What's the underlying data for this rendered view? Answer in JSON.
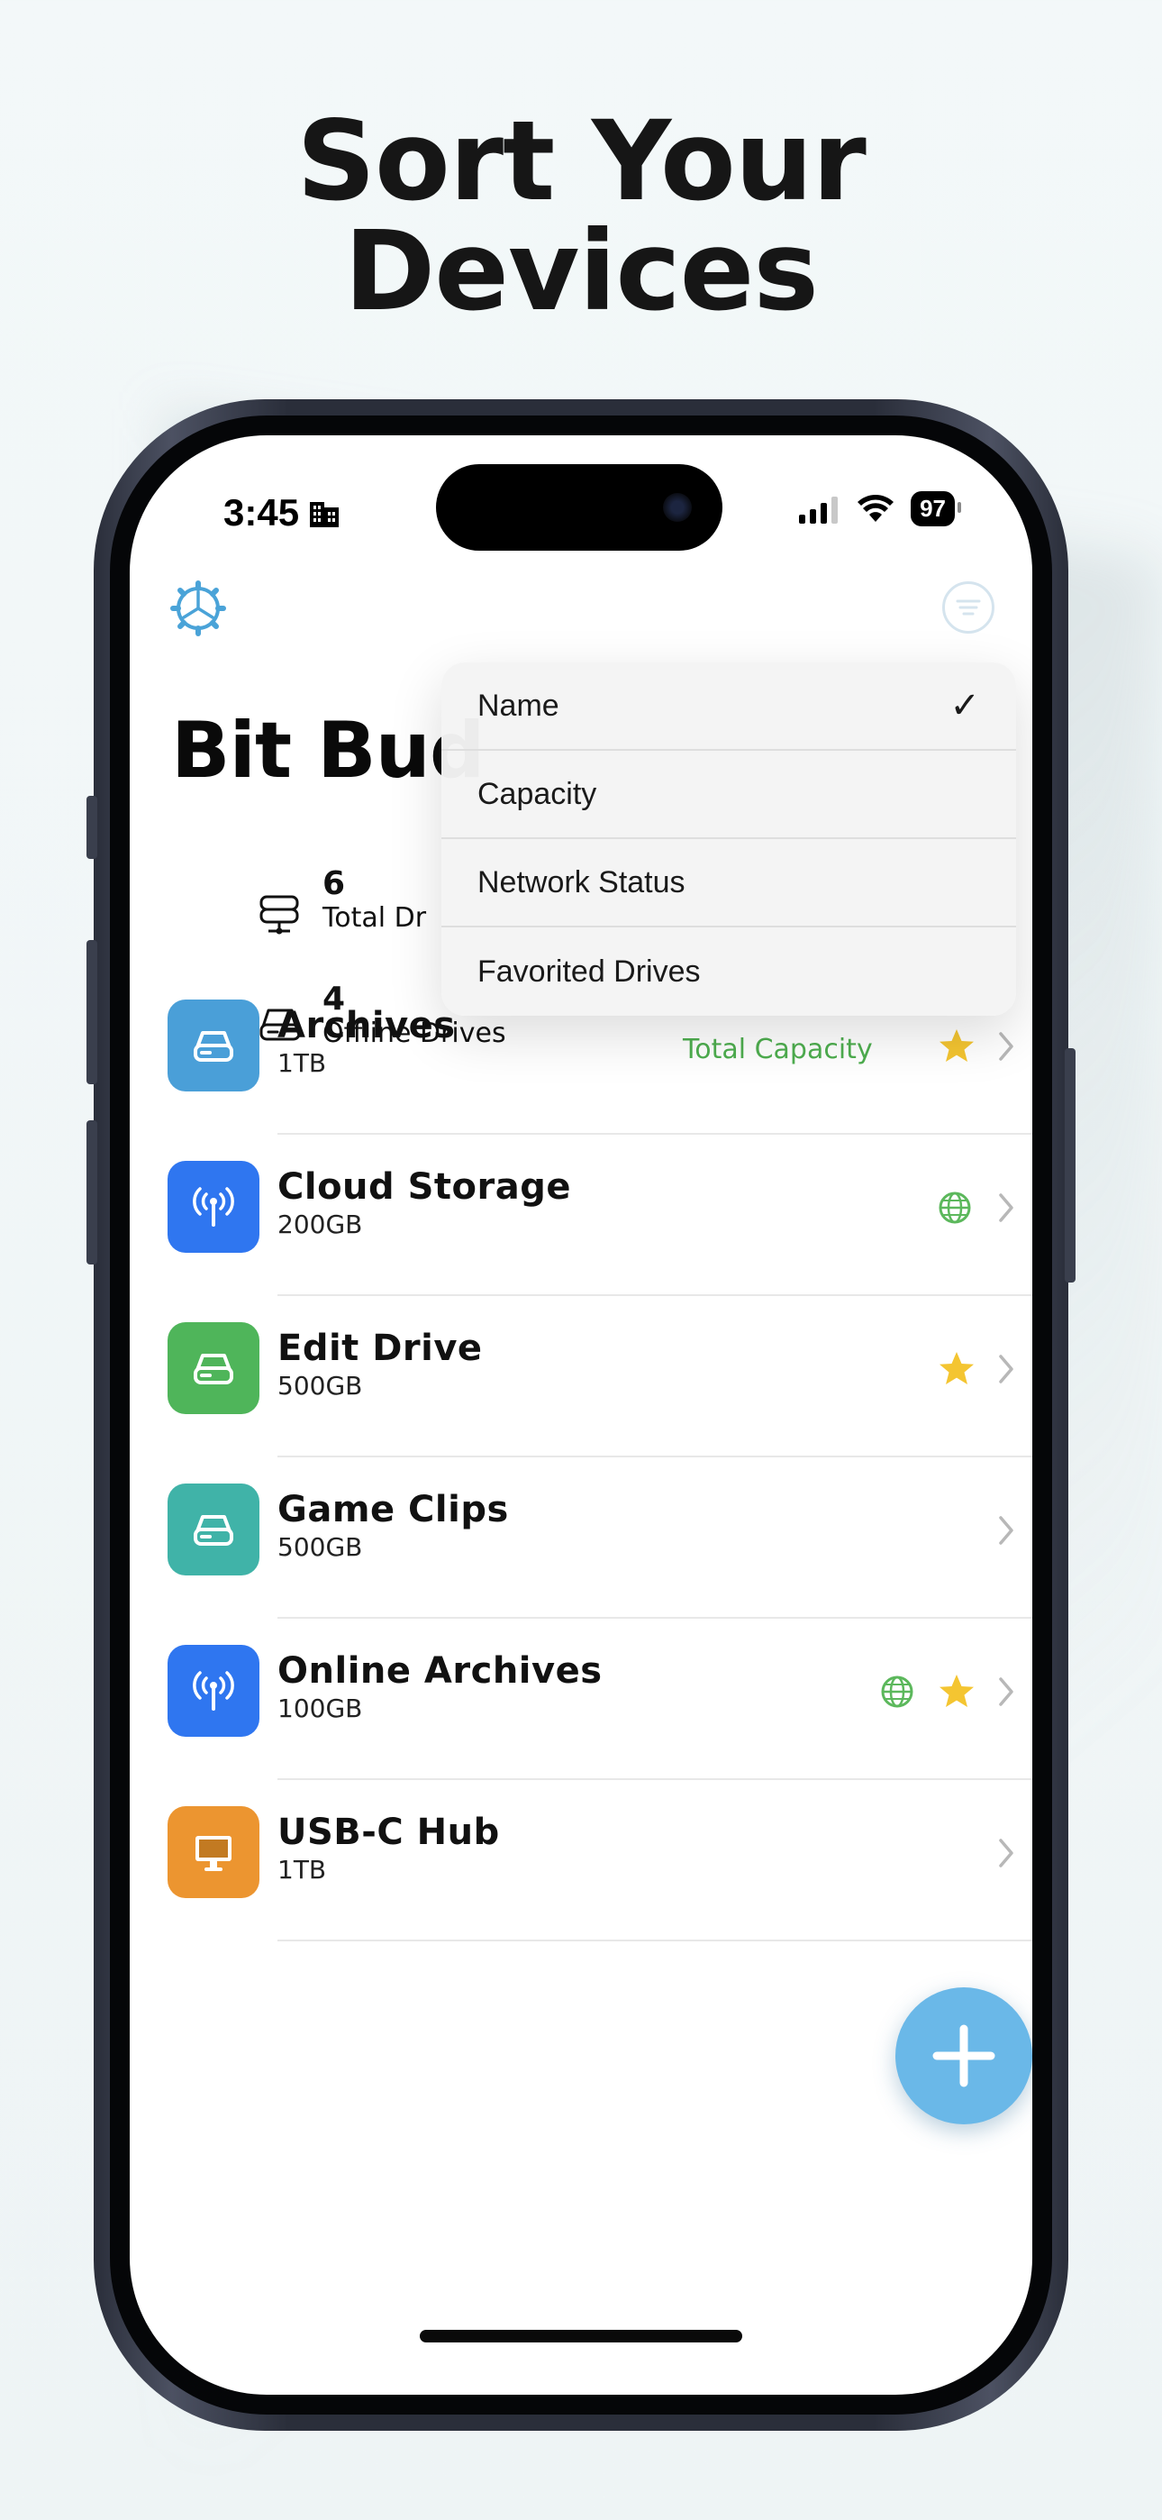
{
  "headline": {
    "line1": "Sort Your",
    "line2": "Devices"
  },
  "status_bar": {
    "time": "3:45",
    "battery": "97"
  },
  "app": {
    "title": "Bit Bud"
  },
  "stats": [
    {
      "value": "6",
      "label": "Total Dr",
      "icon": "drive-stack-icon"
    },
    {
      "value": "4",
      "label": "Offline Drives",
      "icon": "drive-icon"
    },
    {
      "label": "Total Capacity",
      "color": "#4eae4f"
    }
  ],
  "sort_menu": {
    "items": [
      {
        "label": "Name",
        "checked": true,
        "check": "✓"
      },
      {
        "label": "Capacity",
        "checked": false
      },
      {
        "label": "Network Status",
        "checked": false
      },
      {
        "label": "Favorited Drives",
        "checked": false
      }
    ]
  },
  "drives": [
    {
      "name": "Archives",
      "size": "1TB",
      "icon": "hard-drive-icon",
      "color": "#4a9fd8",
      "favorite": true,
      "network": false
    },
    {
      "name": "Cloud Storage",
      "size": "200GB",
      "icon": "antenna-icon",
      "color": "#2f76f0",
      "favorite": false,
      "network": true
    },
    {
      "name": "Edit Drive",
      "size": "500GB",
      "icon": "hard-drive-icon",
      "color": "#4fb55a",
      "favorite": true,
      "network": false
    },
    {
      "name": "Game Clips",
      "size": "500GB",
      "icon": "hard-drive-icon",
      "color": "#40b3a8",
      "favorite": false,
      "network": false
    },
    {
      "name": "Online Archives",
      "size": "100GB",
      "icon": "antenna-icon",
      "color": "#2f76f0",
      "favorite": true,
      "network": true
    },
    {
      "name": "USB-C Hub",
      "size": "1TB",
      "icon": "monitor-icon",
      "color": "#ec9530",
      "favorite": false,
      "network": false
    }
  ],
  "colors": {
    "star": "#f4c531",
    "globe": "#5cb85c",
    "fab": "#6ab8e8",
    "gear": "#4aa3d8"
  }
}
